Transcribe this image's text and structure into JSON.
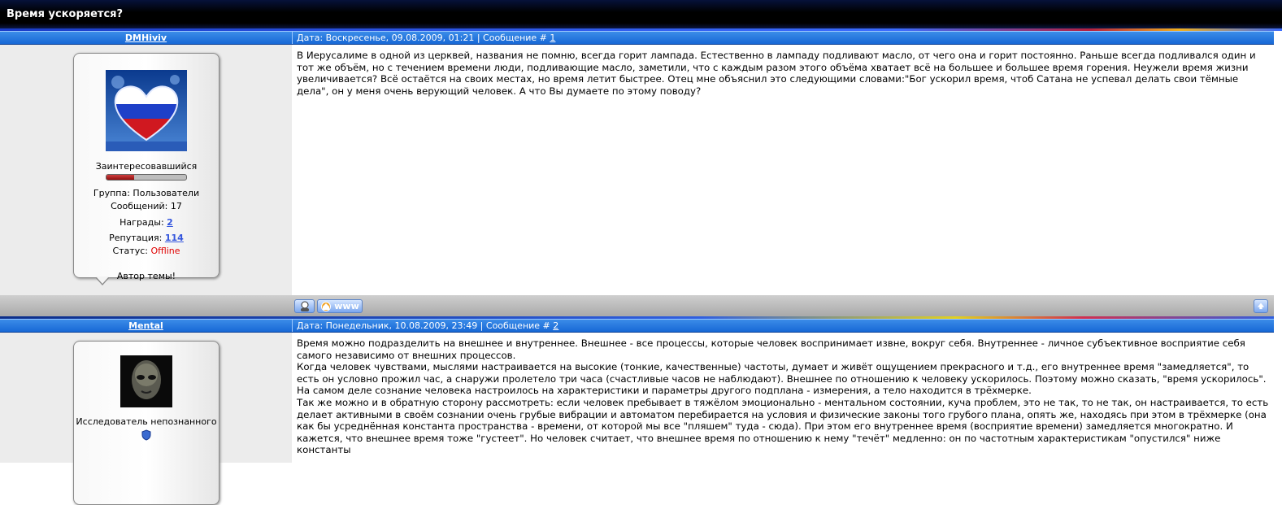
{
  "topic": {
    "title": "Время ускоряется?"
  },
  "posts": [
    {
      "nick": "DMHiviv",
      "meta_prefix": "Дата: Воскресенье, 09.08.2009, 01:21 | Сообщение # ",
      "msg_num": "1",
      "rank": "Заинтересовавшийся",
      "rank_level": 0.35,
      "group": "Группа: Пользователи",
      "messages": "Сообщений: 17",
      "awards_label": "Награды: ",
      "awards_value": "2",
      "rep_label": "Репутация: ",
      "rep_value": "114",
      "status_label": "Статус: ",
      "status_value": "Offline",
      "author_note": "Автор темы!",
      "text": [
        "В Иерусалиме в одной из церквей, названия не помню, всегда горит лампада. Естественно в лампаду подливают масло, от чего она и горит постоянно. Раньше всегда подливался один и тот же объём, но с течением времени люди, подливающие масло, заметили, что с каждым разом этого объёма хватает всё на большее и большее время горения. Неужели время жизни увеличивается? Всё остаётся на своих местах, но время летит быстрее. Отец мне объяснил это следующими словами:\"Бог ускорил время, чтоб Сатана не успевал делать свои тёмные дела\", он у меня очень верующий человек. А что Вы думаете по этому поводу?"
      ],
      "www_label": "www"
    },
    {
      "nick": "Mental",
      "meta_prefix": "Дата: Понедельник, 10.08.2009, 23:49 | Сообщение # ",
      "msg_num": "2",
      "rank": "Исследователь непознанного",
      "text": [
        "Время можно подразделить на внешнее и внутреннее. Внешнее - все процессы, которые человек воспринимает извне, вокруг себя. Внутреннее - личное субъективное восприятие себя самого независимо от внешних процессов.",
        "Когда человек чувствами, мыслями настраивается на высокие (тонкие, качественные) частоты, думает и живёт ощущением прекрасного и т.д., его внутреннее время \"замедляется\", то есть он условно прожил час, а снаружи пролетело три часа (счастливые часов не наблюдают). Внешнее по отношению к человеку ускорилось. Поэтому можно сказать, \"время ускорилось\". На самом деле сознание человека настроилось на характеристики и параметры другого подплана - измерения, а тело находится в трёхмерке.",
        "Так же можно и в обратную сторону рассмотреть: если человек пребывает в тяжёлом эмоционально - ментальном состоянии, куча проблем, это не так, то не так, он настраивается, то есть делает активными в своём сознании очень грубые вибрации и автоматом перебирается на условия и физические законы того грубого плана, опять же, находясь при этом в трёхмерке (она как бы усреднённая константа пространства - времени, от которой мы все \"пляшем\" туда - сюда). При этом его внутреннее время (восприятие времени) замедляется многократно. И кажется, что внешнее время тоже \"густеет\". Но человек считает, что внешнее время по отношению к нему \"течёт\" медленно: он по частотным характеристикам \"опустился\" ниже константы"
      ]
    }
  ],
  "colors": {
    "bar_blue": "#1768d6",
    "offline": "#e00000",
    "link": "#3355dd"
  },
  "icons": [
    "profile-icon",
    "home-www-icon",
    "top-arrow-icon"
  ]
}
